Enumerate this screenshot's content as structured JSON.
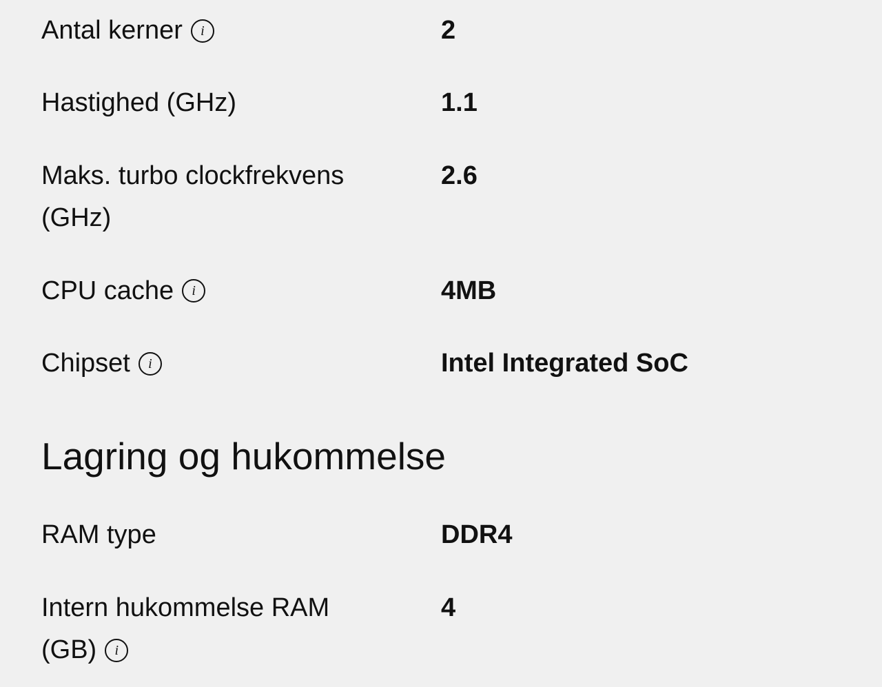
{
  "specs": {
    "antal_kerner": {
      "label": "Antal kerner",
      "value": "2",
      "has_info": true
    },
    "hastighed": {
      "label": "Hastighed (GHz)",
      "value": "1.1",
      "has_info": false
    },
    "maks_turbo": {
      "label_line1": "Maks. turbo clockfrekvens",
      "label_line2": "(GHz)",
      "value": "2.6",
      "has_info": false
    },
    "cpu_cache": {
      "label": "CPU cache",
      "value": "4MB",
      "has_info": true
    },
    "chipset": {
      "label": "Chipset",
      "value": "Intel Integrated SoC",
      "has_info": true
    }
  },
  "section": {
    "title": "Lagring og hukommelse"
  },
  "memory_specs": {
    "ram_type": {
      "label": "RAM type",
      "value": "DDR4",
      "has_info": false
    },
    "intern_hukommelse": {
      "label_line1": "Intern hukommelse RAM",
      "label_line2": "(GB)",
      "value": "4",
      "has_info": true
    }
  },
  "icons": {
    "info": "i"
  }
}
